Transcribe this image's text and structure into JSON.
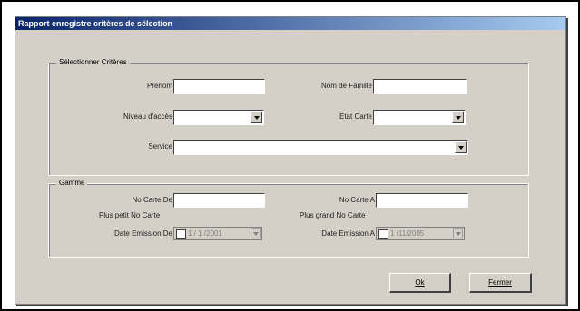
{
  "window": {
    "title": "Rapport enregistre critères de sélection"
  },
  "criteria_group": {
    "legend": "Sélectionner Critères",
    "prenom_label": "Prénom",
    "prenom_value": "",
    "nom_label": "Nom de Famille",
    "nom_value": "",
    "niveau_label": "Niveau d'accès",
    "niveau_value": "",
    "etat_label": "Etat Carte",
    "etat_value": "",
    "service_label": "Service",
    "service_value": ""
  },
  "range_group": {
    "legend": "Gamme",
    "card_from_label": "No Carte De",
    "card_from_value": "",
    "card_from_hint": "Plus petit No Carte",
    "card_to_label": "No Carte A",
    "card_to_value": "",
    "card_to_hint": "Plus grand No Carte",
    "date_from_label": "Date Emission De",
    "date_from_value": "1 / 1 /2001",
    "date_to_label": "Date Emission A",
    "date_to_value": "1 /11/2005"
  },
  "buttons": {
    "ok": "Ok",
    "close": "Fermer"
  },
  "icons": {
    "dropdown": "chevron-down-icon",
    "checkbox": "checkbox-icon"
  }
}
